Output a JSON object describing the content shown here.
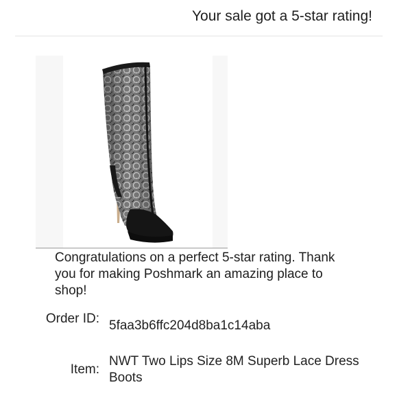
{
  "header": {
    "title": "Your sale got a 5-star rating!"
  },
  "product": {
    "image_description_icon": "boot-icon",
    "colors": {
      "lace": "#8a8a8a",
      "dark": "#1a1a1a",
      "heel": "#c9ad8c"
    }
  },
  "message": {
    "text": "Congratulations on a perfect 5-star rating. Thank you for making Poshmark an amazing place to shop!"
  },
  "details": {
    "order_label": "Order ID:",
    "order_value": "5faa3b6ffc204d8ba1c14aba",
    "item_label": "Item:",
    "item_value": "NWT Two Lips Size 8M Superb Lace Dress Boots"
  }
}
